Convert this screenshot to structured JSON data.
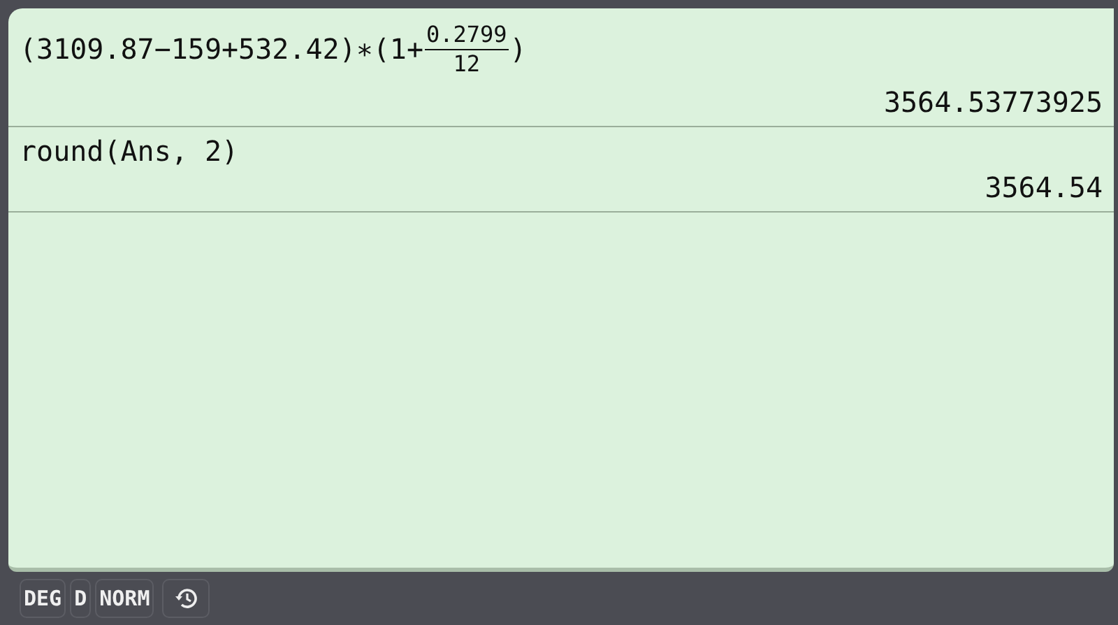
{
  "history": [
    {
      "expression": [
        {
          "kind": "text",
          "text": "(3109.87−159+532.42)∗(1+"
        },
        {
          "kind": "fraction",
          "numerator": "0.2799",
          "denominator": "12"
        },
        {
          "kind": "text",
          "text": ")"
        }
      ],
      "result": "3564.53773925"
    },
    {
      "expression": [
        {
          "kind": "text",
          "text": "round(Ans, 2)"
        }
      ],
      "result": "3564.54"
    }
  ],
  "status_bar": [
    {
      "kind": "text",
      "label": "DEG"
    },
    {
      "kind": "text",
      "label": "D"
    },
    {
      "kind": "text",
      "label": "NORM"
    },
    {
      "kind": "history"
    }
  ]
}
